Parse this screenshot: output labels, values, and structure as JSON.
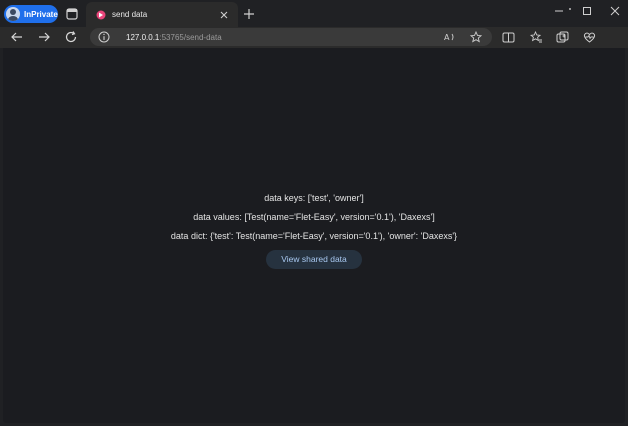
{
  "browser": {
    "inprivate_label": "InPrivate",
    "tab": {
      "title": "send data"
    },
    "address": {
      "host": "127.0.0.1",
      "path": ":53765/send-data"
    },
    "accent_color": "#1f6feb"
  },
  "icons": {
    "tabs": "tab-actions-icon",
    "favicon": "flet-favicon-icon",
    "close": "close-icon",
    "new_tab": "plus-icon",
    "back": "arrow-left-icon",
    "forward": "arrow-right-icon",
    "refresh": "refresh-icon",
    "info": "info-icon",
    "read_aloud": "read-aloud-icon",
    "favorite": "star-icon",
    "split": "split-screen-icon",
    "favorites": "favorites-icon",
    "collections": "collections-icon",
    "copilot": "heart-pulse-icon"
  },
  "page": {
    "keys_line": "data keys: ['test', 'owner']",
    "values_line": "data values: [Test(name='Flet-Easy', version='0.1'), 'Daxexs']",
    "dict_line": "data dict: {'test': Test(name='Flet-Easy', version='0.1'), 'owner': 'Daxexs'}",
    "view_button": "View shared data"
  }
}
